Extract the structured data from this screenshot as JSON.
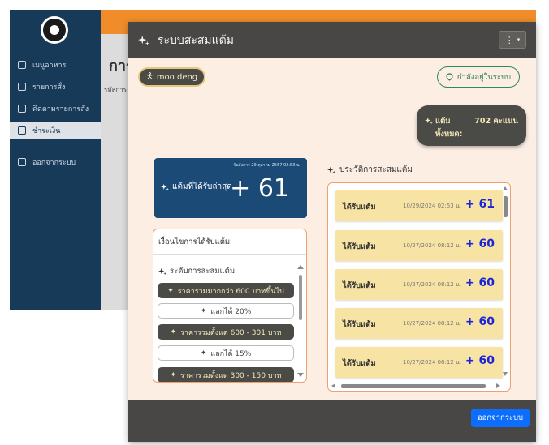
{
  "background": {
    "sidebar_items": [
      {
        "label": "เมนูอาหาร"
      },
      {
        "label": "รายการสั่ง"
      },
      {
        "label": "คิดตามรายการสั่ง"
      },
      {
        "label": "ชำระเงิน"
      },
      {
        "label": "ออกจากระบบ"
      }
    ],
    "page_title": "การ",
    "page_sub": "รหัสการ"
  },
  "modal": {
    "title": "ระบบสะสมแต้ม",
    "menu_icon": "kebab-icon",
    "user_name": "moo deng",
    "status": "กำลังอยู่ในระบบ",
    "total": {
      "label_line1": "แต้ม",
      "label_line2": "ทั้งหมด:",
      "value": "702 คะแนน"
    },
    "latest": {
      "date": "วันอังคาร 29 ตุลาคม 2567 02:53 น.",
      "label": "แต้มที่ได้รับล่าสุด",
      "value": "+ 61"
    },
    "conditions": {
      "title": "เงื่อนไขการได้รับแต้ม",
      "tier_title": "ระดับการสะสมแต้ม",
      "tiers": [
        {
          "label": "ราคารวมมากกว่า 600 บาทขึ้นไป"
        },
        {
          "label": "แลกได้ 20%"
        },
        {
          "label": "ราคารวมตั้งแต่ 600 - 301 บาท"
        },
        {
          "label": "แลกได้ 15%"
        },
        {
          "label": "ราคารวมตั้งแต่ 300 - 150 บาท"
        }
      ]
    },
    "history": {
      "title": "ประวัติการสะสมแต้ม",
      "items": [
        {
          "label": "ได้รับแต้ม",
          "date": "10/29/2024 02:53 น.",
          "points": "+ 61"
        },
        {
          "label": "ได้รับแต้ม",
          "date": "10/27/2024 08:12 น.",
          "points": "+ 60"
        },
        {
          "label": "ได้รับแต้ม",
          "date": "10/27/2024 08:12 น.",
          "points": "+ 60"
        },
        {
          "label": "ได้รับแต้ม",
          "date": "10/27/2024 08:12 น.",
          "points": "+ 60"
        },
        {
          "label": "ได้รับแต้ม",
          "date": "10/27/2024 08:12 น.",
          "points": "+ 60"
        }
      ]
    },
    "logout_label": "ออกจากระบบ"
  },
  "colors": {
    "header": "#484745",
    "accent": "#0d6efd",
    "points": "#1d24d8",
    "card": "#1a4a75"
  }
}
